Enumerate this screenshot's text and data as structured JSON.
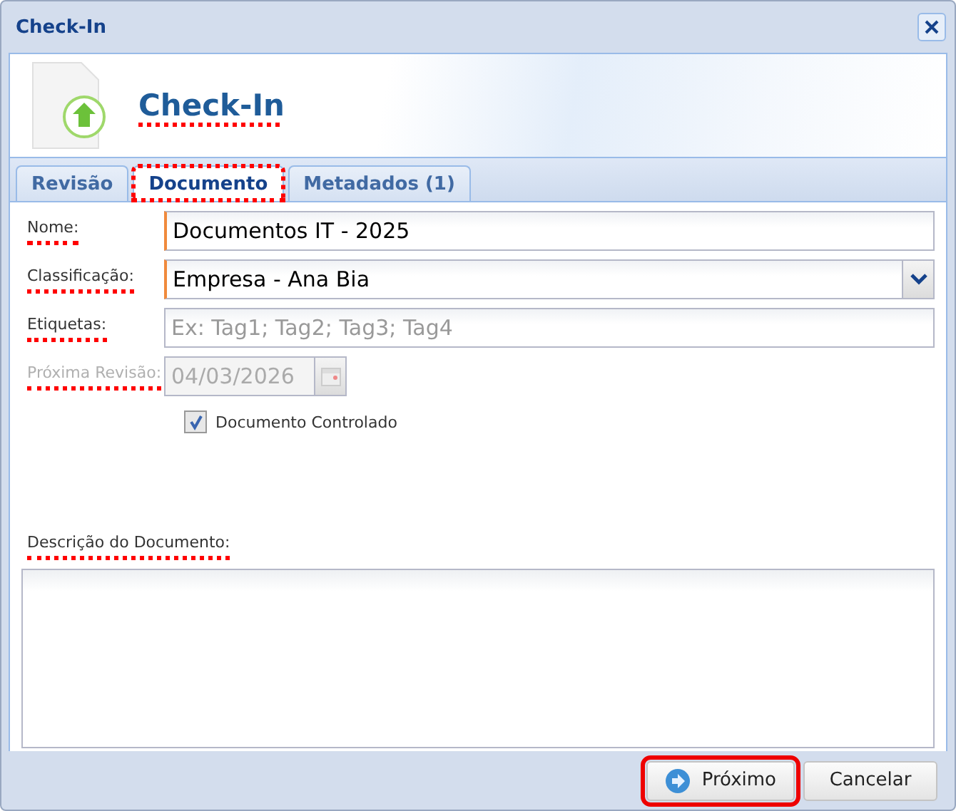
{
  "window": {
    "title": "Check-In"
  },
  "header": {
    "title": "Check-In",
    "marked": true
  },
  "tabs": [
    {
      "label": "Revisão",
      "selected": false,
      "marked": false
    },
    {
      "label": "Documento",
      "selected": true,
      "marked": true
    },
    {
      "label": "Metadados (1)",
      "selected": false,
      "marked": false
    }
  ],
  "fields": [
    {
      "kind": "text",
      "label": "Nome:",
      "value": "Documentos IT - 2025",
      "focused": true,
      "disabled": false,
      "marked": true
    },
    {
      "kind": "select",
      "label": "Classificação:",
      "value": "Empresa - Ana Bia",
      "focused": true,
      "disabled": false,
      "marked": true
    },
    {
      "kind": "text",
      "label": "Etiquetas:",
      "placeholder": "Ex: Tag1; Tag2; Tag3; Tag4",
      "focused": false,
      "disabled": false,
      "marked": true
    },
    {
      "kind": "date",
      "label": "Próxima Revisão:",
      "value": "04/03/2026",
      "focused": false,
      "disabled": true,
      "marked": true
    }
  ],
  "checkbox": {
    "label": "Documento Controlado",
    "checked": true
  },
  "description": {
    "label": "Descrição do Documento:",
    "marked": true
  },
  "buttons": [
    {
      "kind": "next",
      "label": "Próximo",
      "highlighted": true
    },
    {
      "kind": "cancel",
      "label": "Cancelar",
      "highlighted": false
    }
  ]
}
